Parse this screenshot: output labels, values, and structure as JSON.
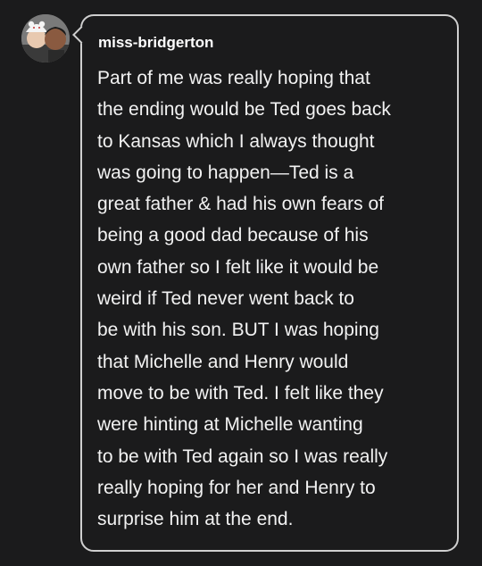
{
  "post": {
    "username": "miss-bridgerton",
    "message_lines": [
      "Part of me was really hoping that",
      "the ending would be Ted goes back",
      "to Kansas which I always thought",
      "was going to happen—Ted is a",
      "great father & had his own fears of",
      "being a good dad because of his",
      "own father so I felt like it would be",
      "weird if Ted never went back to",
      "be with his son. BUT I was hoping",
      "that Michelle and Henry would",
      "move to be with Ted. I felt like they",
      "were hinting at Michelle wanting",
      "to be with Ted again so I was really",
      "really hoping for her and Henry to",
      "surprise him at the end."
    ]
  },
  "colors": {
    "background": "#1b1b1c",
    "bubble_border": "#cfcfcf",
    "text": "#f2f2f2"
  }
}
